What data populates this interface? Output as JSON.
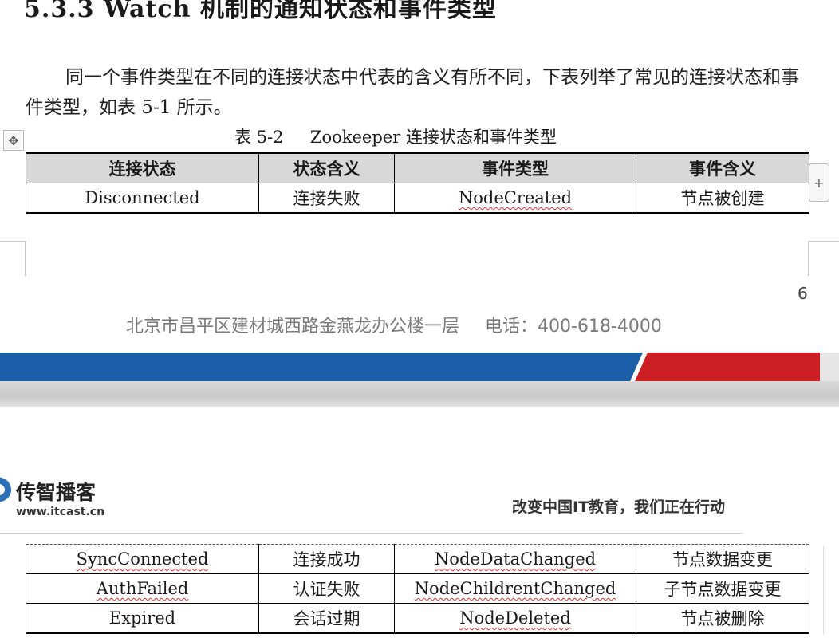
{
  "heading": "5.3.3  Watch 机制的通知状态和事件类型",
  "paragraph": "同一个事件类型在不同的连接状态中代表的含义有所不同，下表列举了常见的连接状态和事件类型，如表 5-1 所示。",
  "caption": "表 5-2     Zookeeper 连接状态和事件类型",
  "move_handle_icon": "move-icon",
  "plus_label": "+",
  "table": {
    "headers": [
      "连接状态",
      "状态含义",
      "事件类型",
      "事件含义"
    ],
    "rows_page1": [
      [
        "Disconnected",
        "连接失败",
        "NodeCreated",
        "节点被创建"
      ]
    ],
    "rows_page2": [
      [
        "SyncConnected",
        "连接成功",
        "NodeDataChanged",
        "节点数据变更"
      ],
      [
        "AuthFailed",
        "认证失败",
        "NodeChildrentChanged",
        "子节点数据变更"
      ],
      [
        "Expired",
        "会话过期",
        "NodeDeleted",
        "节点被删除"
      ]
    ]
  },
  "page_number": "6",
  "footer": {
    "address": "北京市昌平区建材城西路金燕龙办公楼一层",
    "phone": "电话：400-618-4000"
  },
  "band_colors": {
    "blue": "#1a5ea7",
    "red": "#cc1f24"
  },
  "header2": {
    "brand": "传智播客",
    "url": "www.itcast.cn",
    "slogan": "改变中国IT教育，我们正在行动",
    "logo_color": "#2a6fb8"
  }
}
